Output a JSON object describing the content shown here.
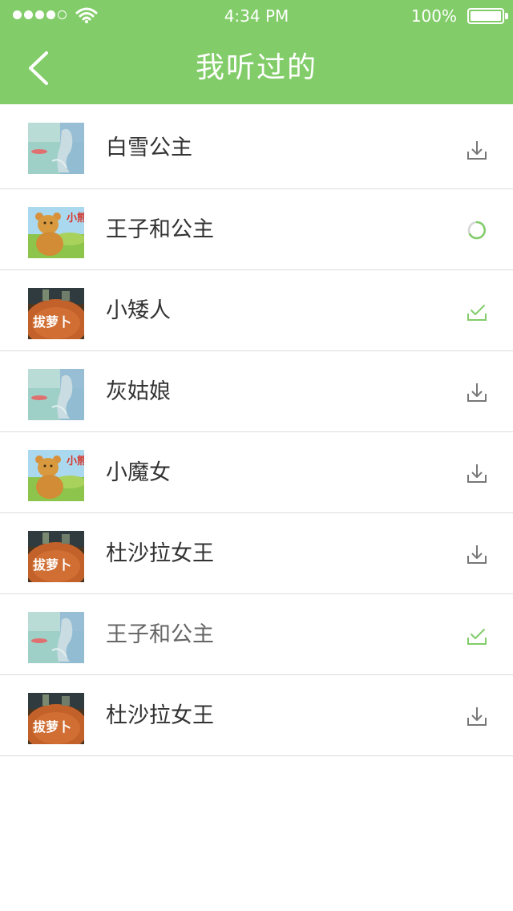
{
  "status_bar": {
    "time": "4:34 PM",
    "battery": "100%",
    "signal_bars": 4,
    "signal_total": 5
  },
  "header": {
    "title": "我听过的",
    "back_icon": "chevron-left-icon",
    "background": "#82cd69"
  },
  "colors": {
    "accent": "#82cd69",
    "icon_gray": "#777777",
    "divider": "#dcdcdc"
  },
  "list": [
    {
      "title": "白雪公主",
      "cover": "fish-cover",
      "state": "download"
    },
    {
      "title": "王子和公主",
      "cover": "bear-cover",
      "state": "downloading"
    },
    {
      "title": "小矮人",
      "cover": "carrot-cover",
      "state": "downloaded"
    },
    {
      "title": "灰姑娘",
      "cover": "fish-cover",
      "state": "download"
    },
    {
      "title": "小魔女",
      "cover": "bear-cover",
      "state": "download"
    },
    {
      "title": "杜沙拉女王",
      "cover": "carrot-cover",
      "state": "download"
    },
    {
      "title": "王子和公主",
      "cover": "fish-cover",
      "state": "downloaded"
    },
    {
      "title": "杜沙拉女王",
      "cover": "carrot-cover",
      "state": "download"
    }
  ],
  "covers": {
    "bear_text": "小熊",
    "carrot_text": "拔萝卜"
  }
}
